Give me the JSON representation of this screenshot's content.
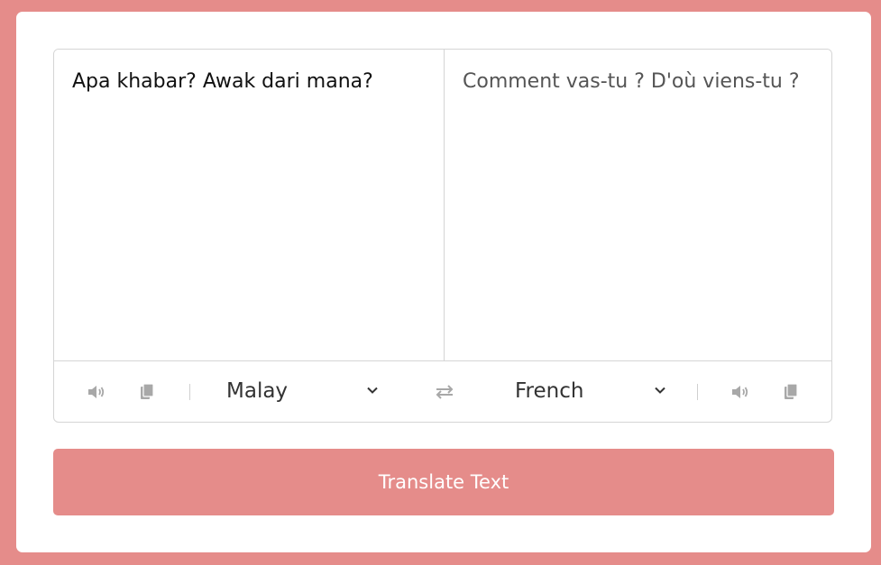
{
  "source": {
    "text": "Apa khabar? Awak dari mana?",
    "language": "Malay"
  },
  "target": {
    "text": "Comment vas-tu ? D'où viens-tu ?",
    "language": "French"
  },
  "button": {
    "label": "Translate Text"
  },
  "icons": {
    "speak": "speaker-icon",
    "copy": "copy-icon",
    "swap": "swap-icon",
    "dropdown": "chevron-down-icon"
  },
  "colors": {
    "accent": "#e58c8a",
    "card": "#ffffff",
    "border": "#d5d5d5",
    "icon": "#a8a8a8"
  }
}
